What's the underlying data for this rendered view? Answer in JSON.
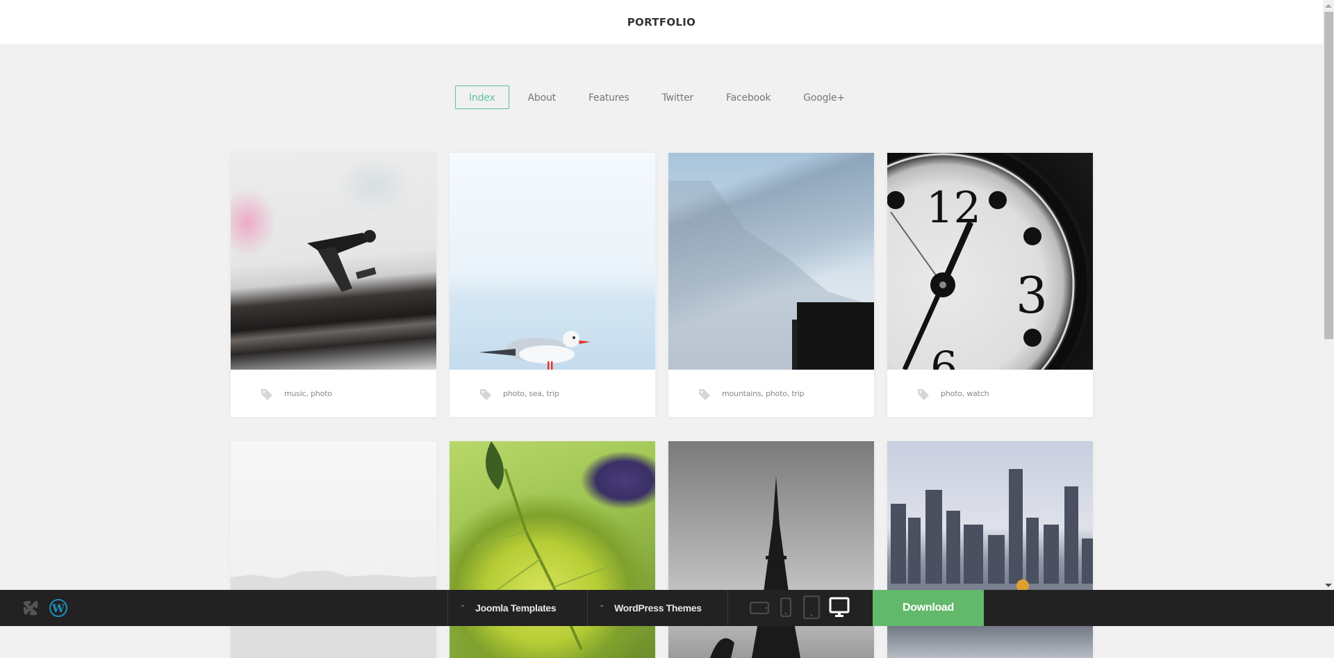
{
  "header": {
    "title": "PORTFOLIO"
  },
  "nav": {
    "items": [
      {
        "label": "Index",
        "active": true
      },
      {
        "label": "About",
        "active": false
      },
      {
        "label": "Features",
        "active": false
      },
      {
        "label": "Twitter",
        "active": false
      },
      {
        "label": "Facebook",
        "active": false
      },
      {
        "label": "Google+",
        "active": false
      }
    ]
  },
  "portfolio": {
    "items": [
      {
        "image": "turntable-photo",
        "tags": "music, photo"
      },
      {
        "image": "seagull-photo",
        "tags": "photo, sea, trip"
      },
      {
        "image": "mountains-pier-photo",
        "tags": "mountains, photo, trip"
      },
      {
        "image": "clock-photo",
        "tags": "photo, watch"
      },
      {
        "image": "foggy-landscape-photo",
        "tags": ""
      },
      {
        "image": "green-leaf-photo",
        "tags": ""
      },
      {
        "image": "eiffel-tower-photo",
        "tags": ""
      },
      {
        "image": "city-skyline-photo",
        "tags": ""
      }
    ]
  },
  "bottombar": {
    "logos": [
      "joomla-logo",
      "wordpress-logo"
    ],
    "menus": [
      {
        "label": "Joomla Templates",
        "icon": "caret-up-icon"
      },
      {
        "label": "WordPress Themes",
        "icon": "caret-up-icon"
      }
    ],
    "devices": [
      {
        "name": "tablet-landscape",
        "active": false
      },
      {
        "name": "phone",
        "active": false
      },
      {
        "name": "tablet-portrait",
        "active": false
      },
      {
        "name": "desktop",
        "active": true
      }
    ],
    "download_label": "Download"
  },
  "colors": {
    "accent": "#5dc1a0",
    "download": "#62b96b",
    "bar_bg": "#222222",
    "page_bg": "#f1f1f1",
    "wordpress_blue": "#1e8cbe"
  }
}
